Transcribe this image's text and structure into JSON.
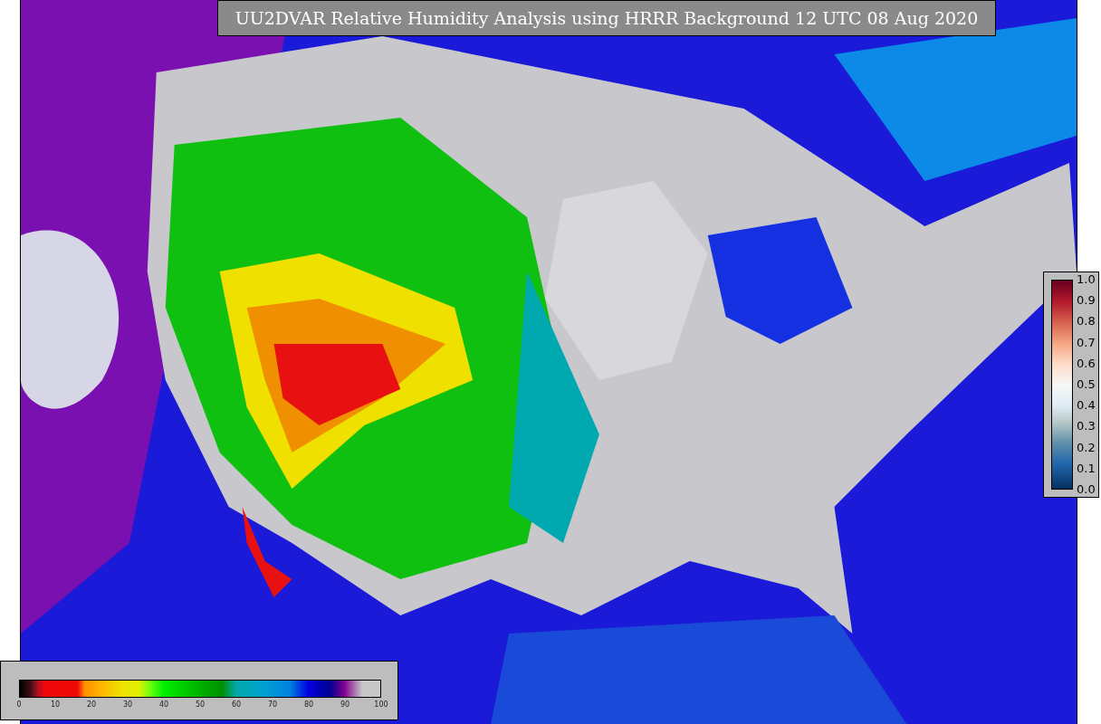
{
  "title": "UU2DVAR Relative Humidity Analysis using HRRR Background 12 UTC 08 Aug 2020",
  "humidity_colorbar": {
    "ticks": [
      "0",
      "10",
      "20",
      "30",
      "40",
      "50",
      "60",
      "70",
      "80",
      "90",
      "100"
    ]
  },
  "station_colorbar": {
    "ticks": [
      "1.0",
      "0.9",
      "0.8",
      "0.7",
      "0.6",
      "0.5",
      "0.4",
      "0.3",
      "0.2",
      "0.1",
      "0.0"
    ]
  }
}
